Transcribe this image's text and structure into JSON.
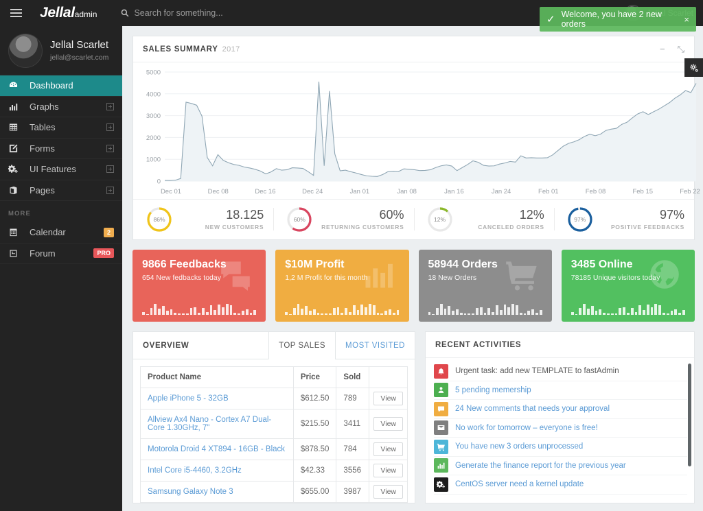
{
  "topbar": {
    "brand_main": "Jellal",
    "brand_sub": "admin",
    "search_placeholder": "Search for something...",
    "user_name": "Jellal Scarlet"
  },
  "toast": {
    "message": "Welcome, you have 2 new orders",
    "close": "×"
  },
  "sidebar": {
    "profile": {
      "name": "Jellal Scarlet",
      "email": "jellal@scarlet.com"
    },
    "items": [
      {
        "label": "Dashboard",
        "icon": "dashboard-icon",
        "active": true,
        "expandable": false
      },
      {
        "label": "Graphs",
        "icon": "bar-chart-icon",
        "active": false,
        "expandable": true
      },
      {
        "label": "Tables",
        "icon": "table-icon",
        "active": false,
        "expandable": true
      },
      {
        "label": "Forms",
        "icon": "form-edit-icon",
        "active": false,
        "expandable": true
      },
      {
        "label": "UI Features",
        "icon": "gears-icon",
        "active": false,
        "expandable": true
      },
      {
        "label": "Pages",
        "icon": "pages-icon",
        "active": false,
        "expandable": true
      }
    ],
    "section_more": "MORE",
    "more_items": [
      {
        "label": "Calendar",
        "icon": "calendar-icon",
        "badge": "2",
        "badge_color": "#f0ad4e"
      },
      {
        "label": "Forum",
        "icon": "forum-icon",
        "badge": "PRO",
        "badge_color": "#e8575a"
      }
    ]
  },
  "sales": {
    "title": "SALES SUMMARY",
    "year": "2017",
    "minimize": "−",
    "expand": "⤡"
  },
  "chart_data": {
    "type": "area",
    "title": "SALES SUMMARY 2017",
    "xlabel": "",
    "ylabel": "",
    "ylim": [
      0,
      5000
    ],
    "yticks": [
      0,
      1000,
      2000,
      3000,
      4000,
      5000
    ],
    "xticks": [
      "Dec 01",
      "Dec 08",
      "Dec 16",
      "Dec 24",
      "Jan 01",
      "Jan 08",
      "Jan 16",
      "Jan 24",
      "Feb 01",
      "Feb 08",
      "Feb 15",
      "Feb 22"
    ],
    "grid": true,
    "legend": "none",
    "line_color": "#8fa6b4",
    "fill_color": "#eef3f6",
    "values": [
      30,
      25,
      40,
      120,
      3620,
      3560,
      3480,
      2980,
      1080,
      700,
      1210,
      950,
      840,
      760,
      720,
      640,
      600,
      540,
      460,
      330,
      420,
      570,
      500,
      520,
      610,
      600,
      580,
      430,
      260,
      4560,
      700,
      4130,
      1250,
      470,
      500,
      430,
      370,
      300,
      240,
      220,
      210,
      300,
      430,
      450,
      440,
      560,
      540,
      520,
      480,
      490,
      520,
      620,
      700,
      740,
      690,
      480,
      620,
      760,
      930,
      860,
      720,
      690,
      700,
      780,
      830,
      900,
      870,
      1160,
      1060,
      1070,
      1060,
      1060,
      1070,
      1200,
      1400,
      1600,
      1730,
      1800,
      1900,
      2050,
      2150,
      2080,
      2150,
      2320,
      2380,
      2420,
      2600,
      2700,
      2900,
      3080,
      3180,
      3050,
      3180,
      3300,
      3450,
      3600,
      3800,
      3950,
      4150,
      4060,
      4480
    ]
  },
  "kpis": [
    {
      "percent": "86%",
      "value": "18.125",
      "caption": "NEW CUSTOMERS",
      "pct": 86,
      "color": "#f0c419"
    },
    {
      "percent": "60%",
      "value": "60%",
      "caption": "RETURNING CUSTOMERS",
      "pct": 60,
      "color": "#d9455f"
    },
    {
      "percent": "12%",
      "value": "12%",
      "caption": "CANCELED ORDERS",
      "pct": 12,
      "color": "#8bb829"
    },
    {
      "percent": "97%",
      "value": "97%",
      "caption": "POSITIVE FEEDBACKS",
      "pct": 97,
      "color": "#1a5f9e"
    }
  ],
  "tiles": [
    {
      "title": "9866 Feedbacks",
      "sub": "654 New fedbacks today",
      "color": "#e8645a",
      "icon": "speech-bubbles-icon"
    },
    {
      "title": "$10M Profit",
      "sub": "1,2 M Profit for this month",
      "color": "#f0ad41",
      "icon": "bar-chart-icon"
    },
    {
      "title": "58944 Orders",
      "sub": "18 New Orders",
      "color": "#8d8d8d",
      "icon": "shopping-cart-icon"
    },
    {
      "title": "3485 Online",
      "sub": "78185 Unique visitors today",
      "color": "#52c060",
      "icon": "globe-icon"
    }
  ],
  "spark_bars": [
    12,
    4,
    34,
    52,
    30,
    42,
    20,
    26,
    10,
    8,
    6,
    6,
    34,
    38,
    10,
    34,
    14,
    46,
    22,
    50,
    36,
    54,
    48,
    10,
    8,
    20,
    26,
    10,
    24
  ],
  "overview": {
    "title": "OVERVIEW",
    "tabs": [
      {
        "label": "TOP SALES",
        "selected": true
      },
      {
        "label": "MOST VISITED",
        "selected": false
      }
    ],
    "columns": [
      "Product Name",
      "Price",
      "Sold",
      ""
    ],
    "view_label": "View",
    "rows": [
      {
        "name": "Apple iPhone 5 - 32GB",
        "price": "$612.50",
        "sold": "789"
      },
      {
        "name": "Allview Ax4 Nano - Cortex A7 Dual-Core 1.30GHz, 7\"",
        "price": "$215.50",
        "sold": "3411"
      },
      {
        "name": "Motorola Droid 4 XT894 - 16GB - Black",
        "price": "$878.50",
        "sold": "784"
      },
      {
        "name": "Intel Core i5-4460, 3.2GHz",
        "price": "$42.33",
        "sold": "3556"
      },
      {
        "name": "Samsung Galaxy Note 3",
        "price": "$655.00",
        "sold": "3987"
      }
    ]
  },
  "activities": {
    "title": "RECENT ACTIVITIES",
    "items": [
      {
        "text": "Urgent task: add new TEMPLATE to fastAdmin",
        "icon": "bell-icon",
        "color": "#e0474c",
        "dark_text": true
      },
      {
        "text": "5 pending memership",
        "icon": "user-icon",
        "color": "#4caf50",
        "dark_text": false
      },
      {
        "text": "24 New comments that needs your approval",
        "icon": "comment-icon",
        "color": "#f0ad41",
        "dark_text": false
      },
      {
        "text": "No work for tomorrow – everyone is free!",
        "icon": "envelope-icon",
        "color": "#7f7f7f",
        "dark_text": false
      },
      {
        "text": "You have new 3 orders unprocessed",
        "icon": "cart-icon",
        "color": "#4db6d8",
        "dark_text": false
      },
      {
        "text": "Generate the finance report for the previous year",
        "icon": "bar-chart-icon",
        "color": "#5cb85c",
        "dark_text": false
      },
      {
        "text": "CentOS server need a kernel update",
        "icon": "gears-icon",
        "color": "#1d1d1d",
        "dark_text": false
      }
    ]
  },
  "settings_tab": {
    "icon": "gears-icon"
  }
}
